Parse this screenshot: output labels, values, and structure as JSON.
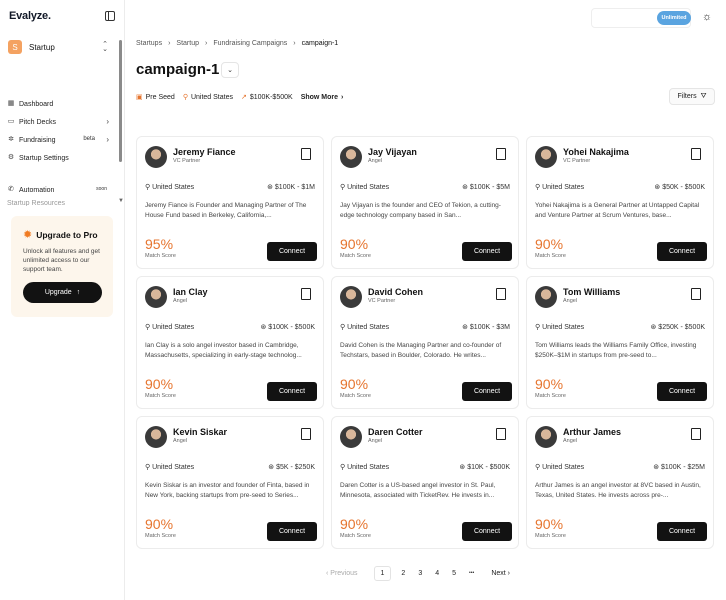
{
  "app": {
    "logo": "Evalyze."
  },
  "startup": {
    "initial": "S",
    "name": "Startup"
  },
  "nav": {
    "items": [
      {
        "label": "Dashboard",
        "icon": "dashboard-icon"
      },
      {
        "label": "Pitch Decks",
        "icon": "presentation-icon"
      },
      {
        "label": "Fundraising",
        "icon": "fundraising-icon",
        "badge": "beta"
      },
      {
        "label": "Startup Settings",
        "icon": "gear-icon"
      }
    ],
    "automation": {
      "label": "Automation",
      "badge": "soon"
    },
    "cut_item": "Startup Resources"
  },
  "upgrade": {
    "title": "Upgrade to Pro",
    "desc": "Unlock all features and get unlimited access to our support team.",
    "button": "Upgrade"
  },
  "topbar": {
    "plan": "Unlimited"
  },
  "breadcrumb": [
    "Startups",
    "Startup",
    "Fundraising Campaigns",
    "campaign-1"
  ],
  "page": {
    "title": "campaign-1"
  },
  "tags": {
    "stage": "Pre Seed",
    "country": "United States",
    "range": "$100K-$500K",
    "more": "Show More",
    "filters": "Filters"
  },
  "cards": [
    {
      "name": "Jeremy Fiance",
      "role": "VC Partner",
      "location": "United States",
      "range": "$100K - $1M",
      "desc": "Jeremy Fiance is Founder and Managing Partner of The House Fund based in Berkeley, California,...",
      "score": "95%",
      "score_label": "Match Score",
      "connect": "Connect"
    },
    {
      "name": "Jay Vijayan",
      "role": "Angel",
      "location": "United States",
      "range": "$100K - $5M",
      "desc": "Jay Vijayan is the founder and CEO of Tekion, a cutting-edge technology company based in San...",
      "score": "90%",
      "score_label": "Match Score",
      "connect": "Connect"
    },
    {
      "name": "Yohei Nakajima",
      "role": "VC Partner",
      "location": "United States",
      "range": "$50K - $500K",
      "desc": "Yohei Nakajima is a General Partner at Untapped Capital and Venture Partner at Scrum Ventures, base...",
      "score": "90%",
      "score_label": "Match Score",
      "connect": "Connect"
    },
    {
      "name": "Ian Clay",
      "role": "Angel",
      "location": "United States",
      "range": "$100K - $500K",
      "desc": "Ian Clay is a solo angel investor based in Cambridge, Massachusetts, specializing in early-stage technolog...",
      "score": "90%",
      "score_label": "Match Score",
      "connect": "Connect"
    },
    {
      "name": "David Cohen",
      "role": "VC Partner",
      "location": "United States",
      "range": "$100K - $3M",
      "desc": "David Cohen is the Managing Partner and co-founder of Techstars, based in Boulder, Colorado. He writes...",
      "score": "90%",
      "score_label": "Match Score",
      "connect": "Connect"
    },
    {
      "name": "Tom Williams",
      "role": "Angel",
      "location": "United States",
      "range": "$250K - $500K",
      "desc": "Tom Williams leads the Williams Family Office, investing $250K–$1M in startups from pre-seed to...",
      "score": "90%",
      "score_label": "Match Score",
      "connect": "Connect"
    },
    {
      "name": "Kevin Siskar",
      "role": "Angel",
      "location": "United States",
      "range": "$5K - $250K",
      "desc": "Kevin Siskar is an investor and founder of Finta, based in New York, backing startups from pre-seed to Series...",
      "score": "90%",
      "score_label": "Match Score",
      "connect": "Connect"
    },
    {
      "name": "Daren Cotter",
      "role": "Angel",
      "location": "United States",
      "range": "$10K - $500K",
      "desc": "Daren Cotter is a US-based angel investor in St. Paul, Minnesota, associated with TicketRev. He invests in...",
      "score": "90%",
      "score_label": "Match Score",
      "connect": "Connect"
    },
    {
      "name": "Arthur James",
      "role": "Angel",
      "location": "United States",
      "range": "$100K - $25M",
      "desc": "Arthur James is an angel investor at 8VC based in Austin, Texas, United States. He invests across pre-...",
      "score": "90%",
      "score_label": "Match Score",
      "connect": "Connect"
    }
  ],
  "pagination": {
    "prev": "Previous",
    "pages": [
      "1",
      "2",
      "3",
      "4",
      "5"
    ],
    "ellipsis": "•••",
    "next": "Next"
  },
  "colors": {
    "accent": "#e6752f",
    "plan_pill": "#5aa4e0",
    "button": "#121212"
  }
}
